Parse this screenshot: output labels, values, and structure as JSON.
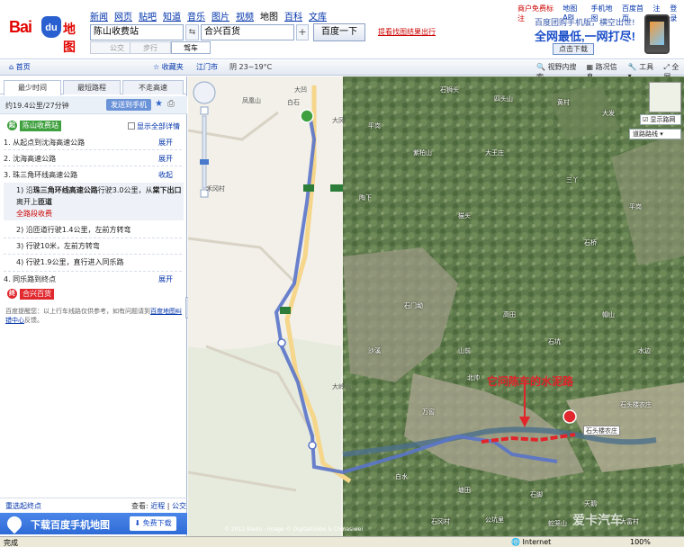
{
  "header": {
    "logo_bai": "Bai",
    "logo_du": "du",
    "logo_ditu": "地图",
    "nav": [
      "新闻",
      "网页",
      "贴吧",
      "知道",
      "音乐",
      "图片",
      "视频",
      "地图",
      "百科",
      "文库"
    ],
    "start_value": "陈山收费站",
    "end_value": "合兴百货",
    "search_label": "百度一下",
    "fuzzy_link": "提看找图结果出行",
    "mode_bus": "公交",
    "mode_walk": "步行",
    "mode_drive": "驾车",
    "top_links": [
      "商户免费标注",
      "地图API",
      "手机地图",
      "百度首页",
      "注册",
      "登录"
    ],
    "ad_line1": "百度团购手机版，横空出世!",
    "ad_line2": "全网最低,一网打尽!",
    "ad_download": "点击下载"
  },
  "toolbar": {
    "home": "首页",
    "fav": "收藏夹",
    "city": "江门市",
    "weather": "阴  23~19°C",
    "tools": [
      "视野内搜索",
      "路况信息",
      "工具",
      "全屏"
    ]
  },
  "sidebar": {
    "tabs": [
      "最少时间",
      "最短路程",
      "不走高速"
    ],
    "summary": "约19.4公里/27分钟",
    "send_phone": "发送到手机",
    "start_pin": "起",
    "start_label": "陈山收费站",
    "expand_all": "显示全部详情",
    "steps": [
      {
        "text": "1. 从起点到沈海高速公路",
        "action": "展开"
      },
      {
        "text": "2. 沈海高速公路",
        "action": "展开"
      },
      {
        "text": "3. 珠三角环线高速公路",
        "action": "收起"
      }
    ],
    "sub1_a": "1) 沿",
    "sub1_road": "珠三角环线高速公路",
    "sub1_b": "行驶3.0公里，从",
    "sub1_exit": "棠下出口",
    "sub1_c": "离开上",
    "sub1_d": "匝道",
    "sub1_fee": "全路段收费",
    "sub2": "2) 沿匝道行驶1.4公里，左前方转弯",
    "sub3": "3) 行驶10米，左前方转弯",
    "sub4": "4) 行驶1.9公里，直行进入同乐路",
    "step4": "4. 同乐路到终点",
    "step4_action": "展开",
    "end_pin": "终",
    "end_label": "合兴百货",
    "notice": "百度提醒您：以上行车线路仅供参考，如有问题请到",
    "notice_link": "百度地图纠错中心",
    "notice_end": "反馈。",
    "reset": "重选起终点",
    "view_label": "查看:",
    "view_near": "近程",
    "view_sep": "|",
    "view_bus": "公交",
    "banner_text": "下载百度手机地图",
    "banner_btn": "免费下载"
  },
  "map": {
    "annotation": "它问陈车的水泥路",
    "dest_tip": "石头楼农庄",
    "show_road": "显示路网",
    "road_net": "道路路线",
    "copyright": "© 2012 Baidu · Image © DigitalGlobe & Chinasiwei",
    "labels": [
      "大凹",
      "凤凰山",
      "禾冈村",
      "白石",
      "大冈",
      "平岗",
      "石狮头",
      "四头山",
      "黄村",
      "大发",
      "紫柏山",
      "大王庄",
      "三丫",
      "陶下",
      "猫头",
      "石桥",
      "平岗",
      "石门坳",
      "高田",
      "帽山",
      "沙溪",
      "山前",
      "石坑",
      "水边",
      "大岭山",
      "万窖",
      "北帅",
      "石头楼农庄",
      "白水",
      "塘田",
      "石脚",
      "天鹅",
      "石冈村",
      "公坑里",
      "蛇笼山",
      "大富村"
    ]
  },
  "status": {
    "done": "完成",
    "internet": "Internet",
    "zoom": "100%"
  },
  "watermark": "爱卡汽车"
}
